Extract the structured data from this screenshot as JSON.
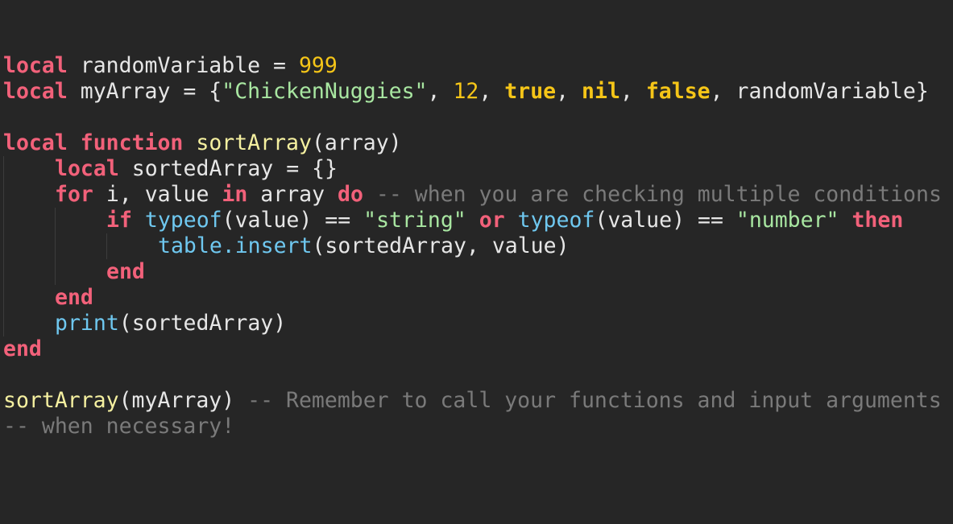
{
  "theme": {
    "background": "#262626",
    "colors": {
      "keyword": "#f2617a",
      "plain": "#e6e6e6",
      "number": "#f5c518",
      "string": "#a8e6a1",
      "constant": "#f5c518",
      "function": "#f5f0a0",
      "builtin": "#6fc8f0",
      "comment": "#7a7a7a",
      "punct": "#e6e6e6"
    }
  },
  "code": {
    "language": "lua",
    "lines": [
      {
        "indent": 0,
        "tokens": [
          {
            "t": "local",
            "k": "keyword"
          },
          {
            "t": " randomVariable = ",
            "k": "plain"
          },
          {
            "t": "999",
            "k": "number"
          }
        ]
      },
      {
        "indent": 0,
        "tokens": [
          {
            "t": "local",
            "k": "keyword"
          },
          {
            "t": " myArray = {",
            "k": "plain"
          },
          {
            "t": "\"ChickenNuggies\"",
            "k": "string"
          },
          {
            "t": ", ",
            "k": "plain"
          },
          {
            "t": "12",
            "k": "number"
          },
          {
            "t": ", ",
            "k": "plain"
          },
          {
            "t": "true",
            "k": "constant"
          },
          {
            "t": ", ",
            "k": "plain"
          },
          {
            "t": "nil",
            "k": "constant"
          },
          {
            "t": ", ",
            "k": "plain"
          },
          {
            "t": "false",
            "k": "constant"
          },
          {
            "t": ", randomVariable}",
            "k": "plain"
          }
        ]
      },
      {
        "indent": 0,
        "tokens": []
      },
      {
        "indent": 0,
        "tokens": [
          {
            "t": "local",
            "k": "keyword"
          },
          {
            "t": " ",
            "k": "plain"
          },
          {
            "t": "function",
            "k": "keyword"
          },
          {
            "t": " ",
            "k": "plain"
          },
          {
            "t": "sortArray",
            "k": "function"
          },
          {
            "t": "(array)",
            "k": "plain"
          }
        ]
      },
      {
        "indent": 1,
        "tokens": [
          {
            "t": "local",
            "k": "keyword"
          },
          {
            "t": " sortedArray = {}",
            "k": "plain"
          }
        ]
      },
      {
        "indent": 1,
        "tokens": [
          {
            "t": "for",
            "k": "keyword"
          },
          {
            "t": " i, value ",
            "k": "plain"
          },
          {
            "t": "in",
            "k": "keyword"
          },
          {
            "t": " array ",
            "k": "plain"
          },
          {
            "t": "do",
            "k": "keyword"
          },
          {
            "t": " -- when you are checking multiple conditions",
            "k": "comment"
          }
        ]
      },
      {
        "indent": 2,
        "tokens": [
          {
            "t": "if",
            "k": "keyword"
          },
          {
            "t": " ",
            "k": "plain"
          },
          {
            "t": "typeof",
            "k": "builtin"
          },
          {
            "t": "(value) == ",
            "k": "plain"
          },
          {
            "t": "\"string\"",
            "k": "string"
          },
          {
            "t": " ",
            "k": "plain"
          },
          {
            "t": "or",
            "k": "keyword"
          },
          {
            "t": " ",
            "k": "plain"
          },
          {
            "t": "typeof",
            "k": "builtin"
          },
          {
            "t": "(value) == ",
            "k": "plain"
          },
          {
            "t": "\"number\"",
            "k": "string"
          },
          {
            "t": " ",
            "k": "plain"
          },
          {
            "t": "then",
            "k": "keyword"
          }
        ]
      },
      {
        "indent": 3,
        "tokens": [
          {
            "t": "table.insert",
            "k": "builtin"
          },
          {
            "t": "(sortedArray, value)",
            "k": "plain"
          }
        ]
      },
      {
        "indent": 2,
        "tokens": [
          {
            "t": "end",
            "k": "keyword"
          }
        ]
      },
      {
        "indent": 1,
        "tokens": [
          {
            "t": "end",
            "k": "keyword"
          }
        ]
      },
      {
        "indent": 1,
        "tokens": [
          {
            "t": "print",
            "k": "builtin"
          },
          {
            "t": "(sortedArray)",
            "k": "plain"
          }
        ]
      },
      {
        "indent": 0,
        "tokens": [
          {
            "t": "end",
            "k": "keyword"
          }
        ]
      },
      {
        "indent": 0,
        "tokens": []
      },
      {
        "indent": 0,
        "tokens": [
          {
            "t": "sortArray",
            "k": "function"
          },
          {
            "t": "(myArray)",
            "k": "plain"
          },
          {
            "t": " -- Remember to call your functions and input arguments",
            "k": "comment"
          }
        ]
      },
      {
        "indent": 0,
        "tokens": [
          {
            "t": "-- when necessary!",
            "k": "comment"
          }
        ]
      }
    ]
  }
}
